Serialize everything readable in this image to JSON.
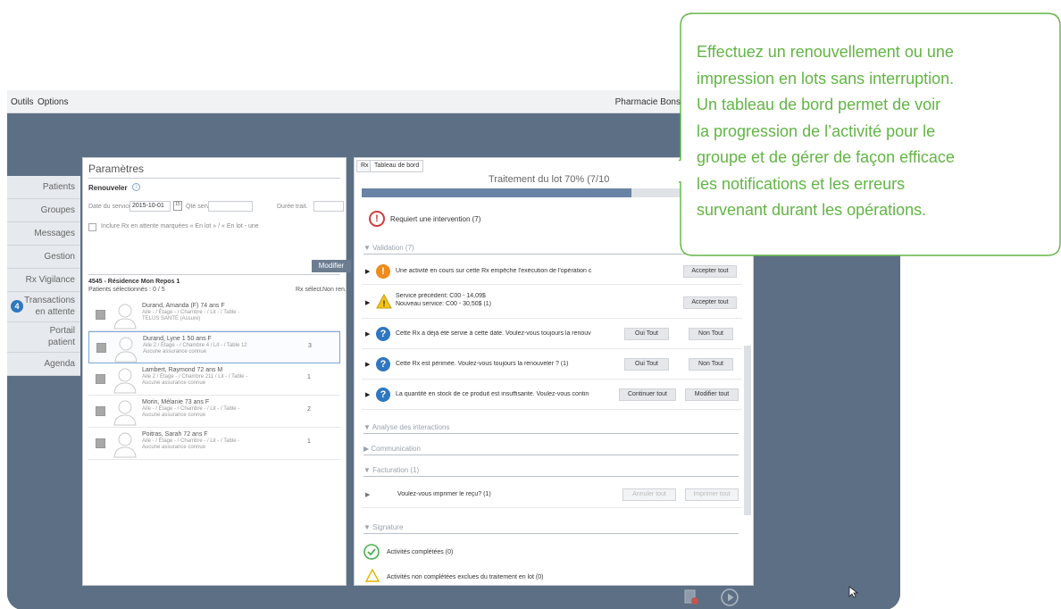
{
  "menubar": {
    "items": [
      "Outils",
      "Options"
    ],
    "app_name": "Pharmacie Bons C"
  },
  "sidebar": {
    "items": [
      "Patients",
      "Groupes",
      "Messages",
      "Gestion",
      "Rx Vigilance",
      "Transactions en attente",
      "Portail patient",
      "Agenda"
    ],
    "transactions_line1": "Transactions",
    "transactions_line2": "en attente",
    "portail_line1": "Portail",
    "portail_line2": "patient",
    "badge": "4"
  },
  "params": {
    "title": "Paramètres",
    "renouveler": "Renouveler",
    "date_label": "Date du service",
    "date_value": "2015-10-01",
    "qte_label": "Qté servie",
    "duree_label": "Durée trait.",
    "include_label": "Inclure Rx en attente marquées « En lot » / « En lot - une",
    "modifier": "Modifier",
    "group_title": "4545 - Résidence Mon Repos 1",
    "patients_selected": "Patients sélectionnés : 0 / 5",
    "rx_sel_header": "Rx sélect.",
    "non_ren_header": "Non ren.",
    "patients": [
      {
        "name": "Durand, Amanda (F)   74 ans F",
        "address": "Aile - / Étage - / Chambre - / Lit - / Table -",
        "insurance": "TELUS SANTÉ (Assure)",
        "rx": ""
      },
      {
        "name": "Durand, Lyne 1   50 ans F",
        "address": "Aile 2 / Étage - / Chambre 4 / Lit - / Table 12",
        "insurance": "Aucune assurance connue",
        "rx": "3"
      },
      {
        "name": "Lambert, Raymond   72 ans M",
        "address": "Aile 2 / Étage - / Chambre 211 / Lit - / Table -",
        "insurance": "Aucune assurance connue",
        "rx": "1"
      },
      {
        "name": "Morin, Mélanie   73 ans F",
        "address": "Aile - / Étage - / Chambre - / Lit - / Table -",
        "insurance": "Aucune assurance connue",
        "rx": "2"
      },
      {
        "name": "Poitras, Sarah   72 ans F",
        "address": "Aile - / Étage - / Chambre - / Lit - / Table -",
        "insurance": "Aucune assurance connue",
        "rx": "1"
      }
    ]
  },
  "dashboard": {
    "tab_rx": "Rx",
    "tab_dashboard": "Tableau de bord",
    "title": "Traitement du lot  70% (7/10",
    "progress": 0.7,
    "intervention": "Requiert une intervention (7)",
    "validation": "Validation (7)",
    "rows": [
      {
        "text": "Une activité en cours sur cette Rx empêche l'exécution de l'opération c",
        "icon": "!",
        "icon_name": "warning-circle-icon",
        "btn1": "",
        "btn2": "Accepter tout"
      },
      {
        "text": "Service précédent: C00 - 14,09$",
        "text2": "Nouveau service: C00 - 30,50$ (1)",
        "icon": "!",
        "icon_name": "warning-triangle-icon",
        "btn1": "",
        "btn2": "Accepter tout"
      },
      {
        "text": "Cette Rx a déjà été servie à cette date. Voulez-vous toujours la renouv",
        "icon": "?",
        "icon_name": "question-icon",
        "btn1": "Oui Tout",
        "btn2": "Non Tout"
      },
      {
        "text": "Cette Rx est périmée. Voulez-vous toujours la renouveler ? (1)",
        "icon": "?",
        "icon_name": "question-icon",
        "btn1": "Oui Tout",
        "btn2": "Non Tout"
      },
      {
        "text": "La quantité en stock de ce produit est insuffisante. Voulez-vous contin",
        "icon": "?",
        "icon_name": "question-icon",
        "btn1": "Continuer tout",
        "btn2": "Modifier tout"
      }
    ],
    "analyse": "Analyse des interactions",
    "communication": "Communication",
    "facturation": "Facturation (1)",
    "recu": "Voulez-vous imprimer le reçu? (1)",
    "annuler": "Annuler tout",
    "imprimer": "Imprimer tout",
    "signature": "Signature",
    "completed": "Activités complétées (0)",
    "non_completed": "Activités non complétées exclues du traitement en lot (0)"
  },
  "bottombar": {
    "icon1": "renew-icon",
    "icon2": "play-icon"
  },
  "callout": {
    "lines": [
      "Effectuez un renouvellement ou une",
      "impression en lots sans interruption.",
      "Un tableau de bord permet de voir",
      "la progression de l’activité pour le",
      "groupe et de gérer de façon efficace",
      "les notifications et les erreurs",
      "survenant durant les opérations."
    ],
    "color": "#62b545"
  }
}
